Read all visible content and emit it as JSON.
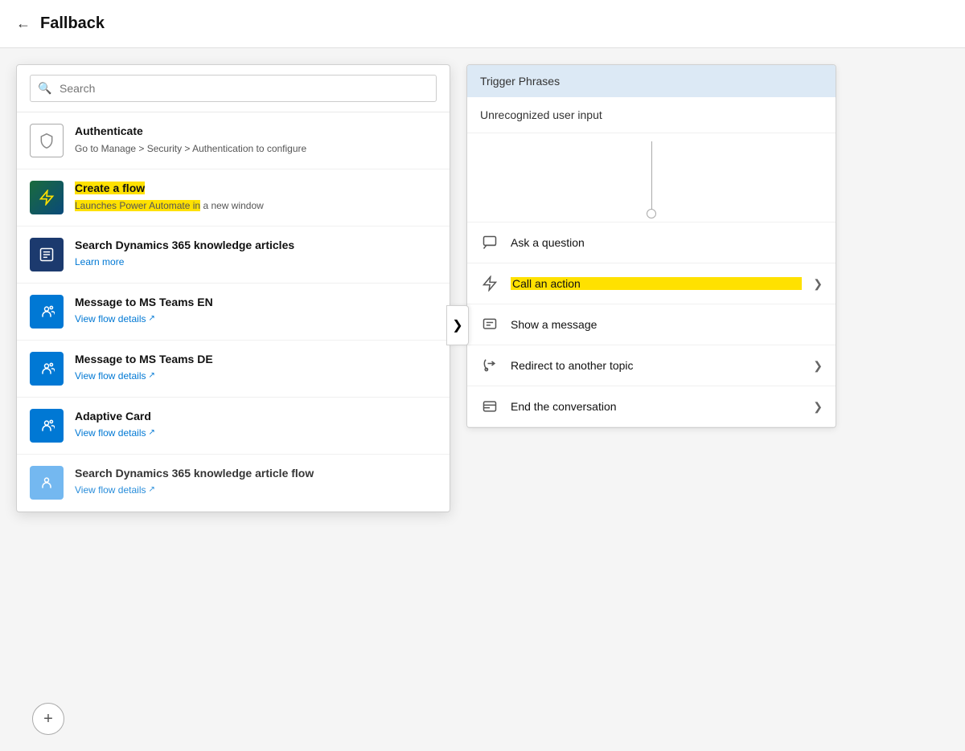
{
  "header": {
    "back_label": "←",
    "title": "Fallback"
  },
  "search": {
    "placeholder": "Search",
    "value": ""
  },
  "list_items": [
    {
      "id": "authenticate",
      "icon_type": "icon-gray",
      "icon_symbol": "shield",
      "title": "Authenticate",
      "subtitle": "Go to Manage > Security > Authentication to configure",
      "link": null,
      "highlighted": false
    },
    {
      "id": "create-flow",
      "icon_type": "icon-green-blue",
      "icon_symbol": "flow",
      "title": "Create a flow",
      "subtitle_prefix": "Launches Power Automate in",
      "subtitle_suffix": " a new window",
      "link": null,
      "highlighted": true
    },
    {
      "id": "search-dynamics",
      "icon_type": "icon-dark-blue",
      "icon_symbol": "doc",
      "title": "Search Dynamics 365 knowledge articles",
      "subtitle": null,
      "link": "Learn more",
      "highlighted": false
    },
    {
      "id": "ms-teams-en",
      "icon_type": "icon-blue",
      "icon_symbol": "teams",
      "title": "Message to MS Teams EN",
      "subtitle": null,
      "link": "View flow details",
      "highlighted": false
    },
    {
      "id": "ms-teams-de",
      "icon_type": "icon-blue",
      "icon_symbol": "teams",
      "title": "Message to MS Teams DE",
      "subtitle": null,
      "link": "View flow details",
      "highlighted": false
    },
    {
      "id": "adaptive-card",
      "icon_type": "icon-blue",
      "icon_symbol": "teams",
      "title": "Adaptive Card",
      "subtitle": null,
      "link": "View flow details",
      "highlighted": false
    },
    {
      "id": "search-dynamics-flow",
      "icon_type": "icon-light-blue",
      "icon_symbol": "teams",
      "title": "Search Dynamics 365 knowledge article flow",
      "subtitle": null,
      "link": "View flow details",
      "highlighted": false
    }
  ],
  "flow_card": {
    "header": "Trigger Phrases",
    "trigger_text": "Unrecognized user input"
  },
  "action_items": [
    {
      "id": "ask-question",
      "icon": "chat",
      "label": "Ask a question",
      "has_arrow": false
    },
    {
      "id": "call-action",
      "icon": "bolt",
      "label": "Call an action",
      "has_arrow": true,
      "highlighted": true
    },
    {
      "id": "show-message",
      "icon": "message",
      "label": "Show a message",
      "has_arrow": false
    },
    {
      "id": "redirect-topic",
      "icon": "redirect",
      "label": "Redirect to another topic",
      "has_arrow": true
    },
    {
      "id": "end-conversation",
      "icon": "end",
      "label": "End the conversation",
      "has_arrow": true
    }
  ],
  "chevron": "❯",
  "bottom_circle_label": "+"
}
